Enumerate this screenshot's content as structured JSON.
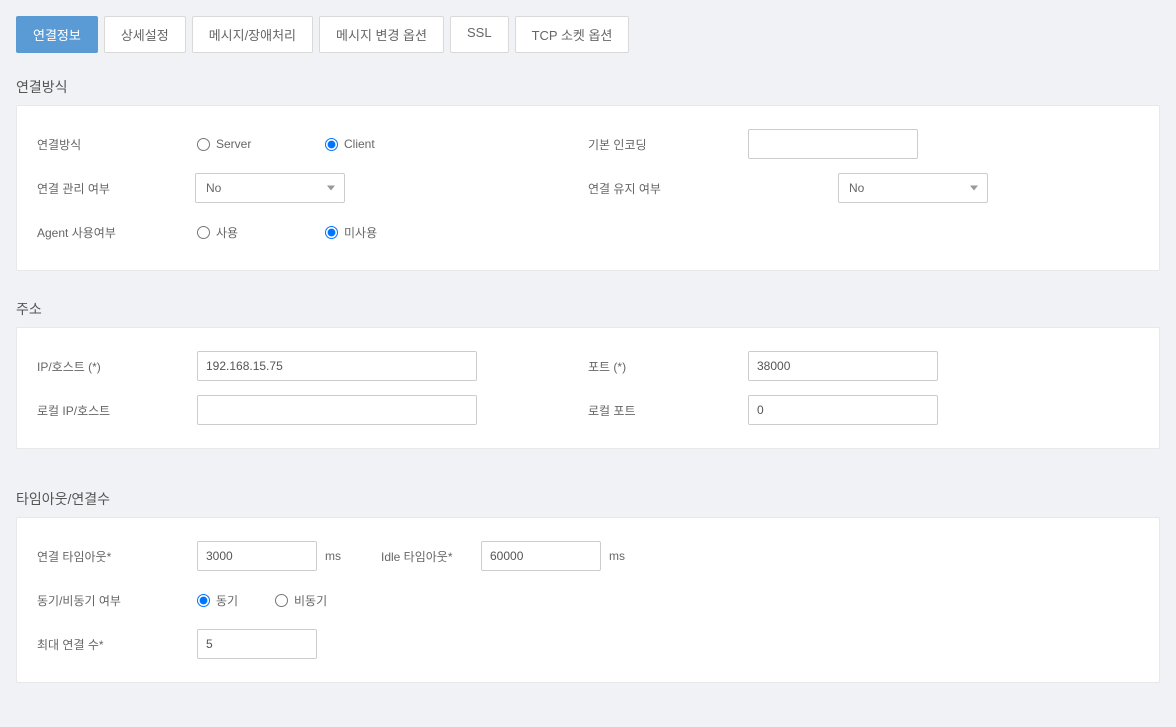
{
  "tabs": {
    "items": [
      {
        "label": "연결정보",
        "active": true
      },
      {
        "label": "상세설정",
        "active": false
      },
      {
        "label": "메시지/장애처리",
        "active": false
      },
      {
        "label": "메시지 변경 옵션",
        "active": false
      },
      {
        "label": "SSL",
        "active": false
      },
      {
        "label": "TCP 소켓 옵션",
        "active": false
      }
    ]
  },
  "sections": {
    "connection_method": {
      "title": "연결방식",
      "fields": {
        "method_label": "연결방식",
        "server_label": "Server",
        "client_label": "Client",
        "default_encoding_label": "기본 인코딩",
        "default_encoding_value": "",
        "manage_label": "연결 관리 여부",
        "manage_value": "No",
        "keep_label": "연결 유지 여부",
        "keep_value": "No",
        "agent_label": "Agent 사용여부",
        "agent_use_label": "사용",
        "agent_nouse_label": "미사용"
      }
    },
    "address": {
      "title": "주소",
      "fields": {
        "ip_label": "IP/호스트 (*)",
        "ip_value": "192.168.15.75",
        "port_label": "포트 (*)",
        "port_value": "38000",
        "local_ip_label": "로컬 IP/호스트",
        "local_ip_value": "",
        "local_port_label": "로컬 포트",
        "local_port_value": "0"
      }
    },
    "timeout": {
      "title": "타임아웃/연결수",
      "fields": {
        "conn_timeout_label": "연결 타임아웃*",
        "conn_timeout_value": "3000",
        "conn_timeout_unit": "ms",
        "idle_timeout_label": "Idle 타임아웃*",
        "idle_timeout_value": "60000",
        "idle_timeout_unit": "ms",
        "sync_label": "동기/비동기 여부",
        "sync_opt_label": "동기",
        "async_opt_label": "비동기",
        "max_conn_label": "최대 연결 수*",
        "max_conn_value": "5"
      }
    }
  }
}
